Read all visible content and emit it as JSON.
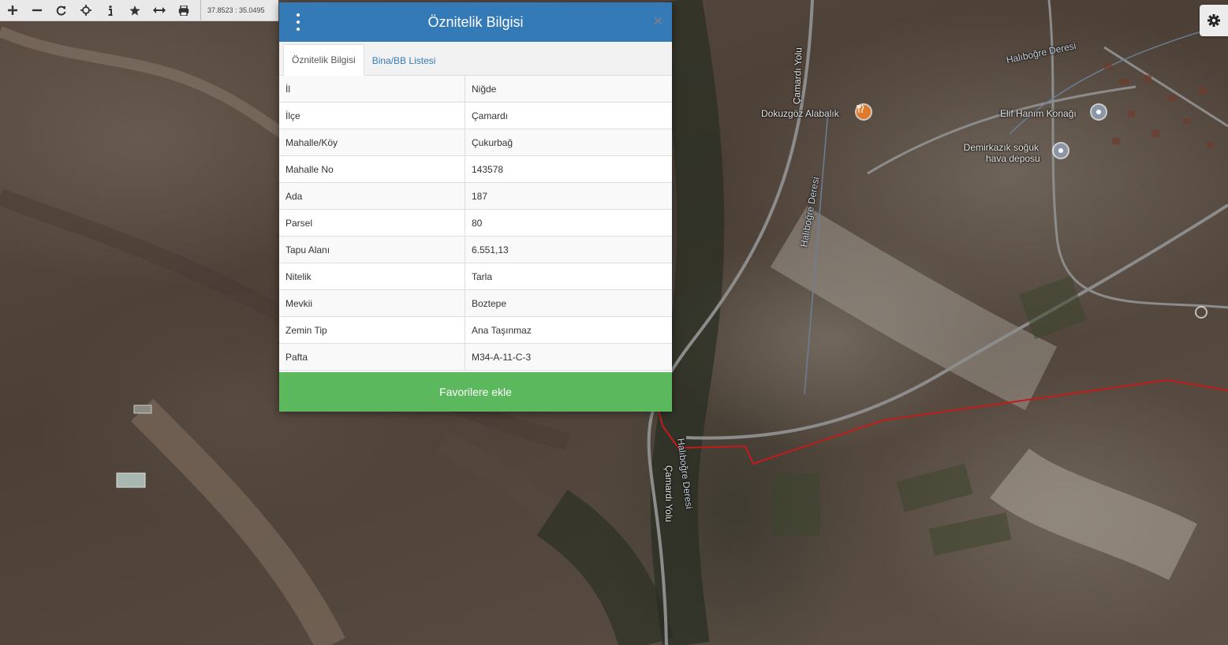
{
  "toolbar": {
    "buttons": [
      {
        "icon": "zoom-in-icon",
        "glyph": "+"
      },
      {
        "icon": "zoom-out-icon",
        "glyph": "−"
      },
      {
        "icon": "refresh-icon",
        "glyph": "⟳"
      },
      {
        "icon": "locate-icon",
        "glyph": "⌖"
      },
      {
        "icon": "info-icon",
        "glyph": "i"
      },
      {
        "icon": "star-icon",
        "glyph": "★"
      },
      {
        "icon": "measure-icon",
        "glyph": "↔"
      },
      {
        "icon": "print-icon",
        "glyph": "⎙"
      }
    ],
    "coordinates": "37.8523 : 35.0495"
  },
  "settings": {
    "icon": "gear-icon"
  },
  "map": {
    "labels": {
      "road_camardi_top": "Çamardı Yolu",
      "stream_halibogre_right": "Halıboğre Deresi",
      "stream_halibogre_mid": "Halıboğre Deresi",
      "poi_dokuzgoz": "Dokuzgöz Alabalık",
      "poi_elif": "Elif Hanım Konağı",
      "poi_demirkazik_1": "Demirkazık soğuk",
      "poi_demirkazik_2": "hava deposu",
      "stream_halibogre_bottom": "Halıboğre Deresi",
      "road_camardi_bottom": "Çamardı Yolu"
    },
    "colors": {
      "parcel_border": "#c41a1a",
      "poi_restaurant": "#e07a2a",
      "poi_place": "#8a96a8"
    }
  },
  "panel": {
    "title": "Öznitelik Bilgisi",
    "tabs": [
      {
        "label": "Öznitelik Bilgisi",
        "active": true
      },
      {
        "label": "Bina/BB Listesi",
        "active": false
      }
    ],
    "rows": [
      {
        "key": "İl",
        "value": "Niğde"
      },
      {
        "key": "İlçe",
        "value": "Çamardı"
      },
      {
        "key": "Mahalle/Köy",
        "value": "Çukurbağ"
      },
      {
        "key": "Mahalle No",
        "value": "143578"
      },
      {
        "key": "Ada",
        "value": "187"
      },
      {
        "key": "Parsel",
        "value": "80"
      },
      {
        "key": "Tapu Alanı",
        "value": "6.551,13"
      },
      {
        "key": "Nitelik",
        "value": "Tarla"
      },
      {
        "key": "Mevkii",
        "value": "Boztepe"
      },
      {
        "key": "Zemin Tip",
        "value": "Ana Taşınmaz"
      },
      {
        "key": "Pafta",
        "value": "M34-A-11-C-3"
      }
    ],
    "favorite_button": "Favorilere ekle",
    "colors": {
      "header": "#337ab7",
      "favorite": "#5cb85c"
    }
  }
}
